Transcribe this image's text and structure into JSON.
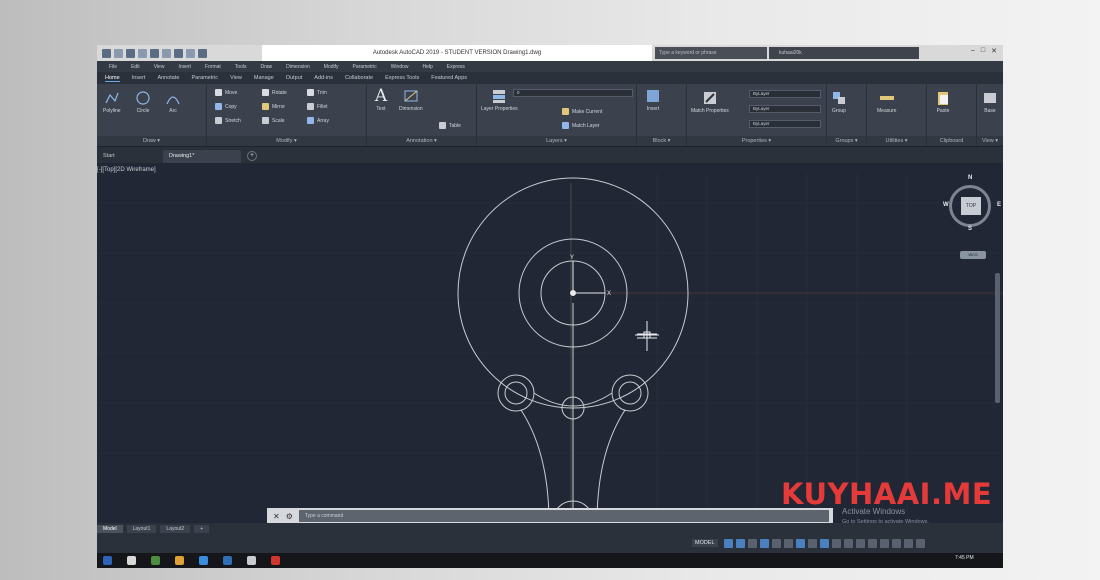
{
  "window": {
    "title": "Autodesk AutoCAD 2019 - STUDENT VERSION    Drawing1.dwg",
    "search_placeholder": "Type a keyword or phrase",
    "user": "kuhaai20k",
    "controls": [
      "–",
      "□",
      "✕"
    ]
  },
  "menubar": [
    "File",
    "Edit",
    "View",
    "Insert",
    "Format",
    "Tools",
    "Draw",
    "Dimension",
    "Modify",
    "Parametric",
    "Window",
    "Help",
    "Express"
  ],
  "ribbon_tabs": [
    "Home",
    "Insert",
    "Annotate",
    "Parametric",
    "View",
    "Manage",
    "Output",
    "Add-ins",
    "Collaborate",
    "Express Tools",
    "Featured Apps"
  ],
  "ribbon": {
    "draw": {
      "title": "Draw ▾",
      "polyline": "Polyline",
      "circle": "Circle",
      "arc": "Arc"
    },
    "modify": {
      "title": "Modify ▾",
      "move": "Move",
      "rotate": "Rotate",
      "trim": "Trim",
      "copy": "Copy",
      "mirror": "Mirror",
      "fillet": "Fillet",
      "stretch": "Stretch",
      "scale": "Scale",
      "array": "Array"
    },
    "annotation": {
      "title": "Annotation ▾",
      "text": "Text",
      "dimension": "Dimension",
      "table": "Table"
    },
    "layers": {
      "title": "Layers ▾",
      "layer_properties": "Layer Properties",
      "make_current": "Make Current",
      "match_layer": "Match Layer",
      "current_layer": "0"
    },
    "block": {
      "title": "Block ▾",
      "insert": "Insert"
    },
    "properties": {
      "title": "Properties ▾",
      "match": "Match Properties",
      "bylayer1": "ByLayer",
      "bylayer2": "ByLayer",
      "bylayer3": "ByLayer"
    },
    "groups": {
      "title": "Groups ▾",
      "group": "Group"
    },
    "utilities": {
      "title": "Utilities ▾",
      "measure": "Measure"
    },
    "clipboard": {
      "title": "Clipboard",
      "paste": "Paste"
    },
    "view": {
      "title": "View ▾",
      "base": "Base"
    }
  },
  "doc_tabs": {
    "start": "Start",
    "drawing": "Drawing1*"
  },
  "viewport": {
    "label": "[-][Top][2D Wireframe]",
    "viewcube": {
      "n": "N",
      "s": "S",
      "w": "W",
      "e": "E",
      "top": "TOP",
      "wcs": "WCS"
    }
  },
  "command_line": {
    "placeholder": "Type a command",
    "close": "✕"
  },
  "activate_windows": {
    "title": "Activate Windows",
    "subtitle": "Go to Settings to activate Windows."
  },
  "layout_tabs": [
    "Model",
    "Layout1",
    "Layout2",
    "+"
  ],
  "status": {
    "model": "MODEL"
  },
  "taskbar": {
    "time": "7:45 PM"
  },
  "watermark": "KUYHAAI.ME",
  "colors": {
    "canvas": "#212734",
    "ribbon": "#3b424d",
    "drawing_lines": "#c9ccd2",
    "watermark": "#e53a3a"
  }
}
